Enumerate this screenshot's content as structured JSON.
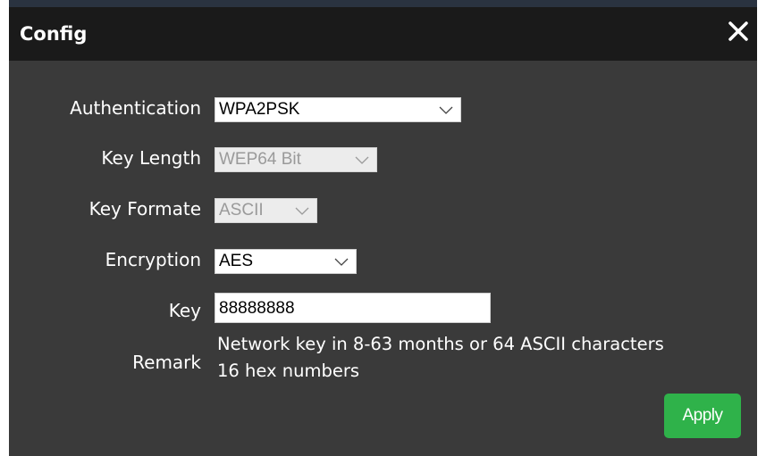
{
  "dialog": {
    "title": "Config",
    "close_icon": "close-icon"
  },
  "form": {
    "authentication": {
      "label": "Authentication",
      "value": "WPA2PSK"
    },
    "key_length": {
      "label": "Key Length",
      "value": "WEP64 Bit",
      "disabled": true
    },
    "key_formate": {
      "label": "Key Formate",
      "value": "ASCII",
      "disabled": true
    },
    "encryption": {
      "label": "Encryption",
      "value": "AES"
    },
    "key": {
      "label": "Key",
      "value": "88888888"
    },
    "remark": {
      "label": "Remark",
      "line1": "Network key in 8-63 months or 64 ASCII characters",
      "line2": "16 hex numbers"
    }
  },
  "actions": {
    "apply_label": "Apply"
  },
  "colors": {
    "title_bar": "#1a1a1a",
    "dialog_bg": "#3a3a3a",
    "apply_bg": "#2fb24a"
  }
}
